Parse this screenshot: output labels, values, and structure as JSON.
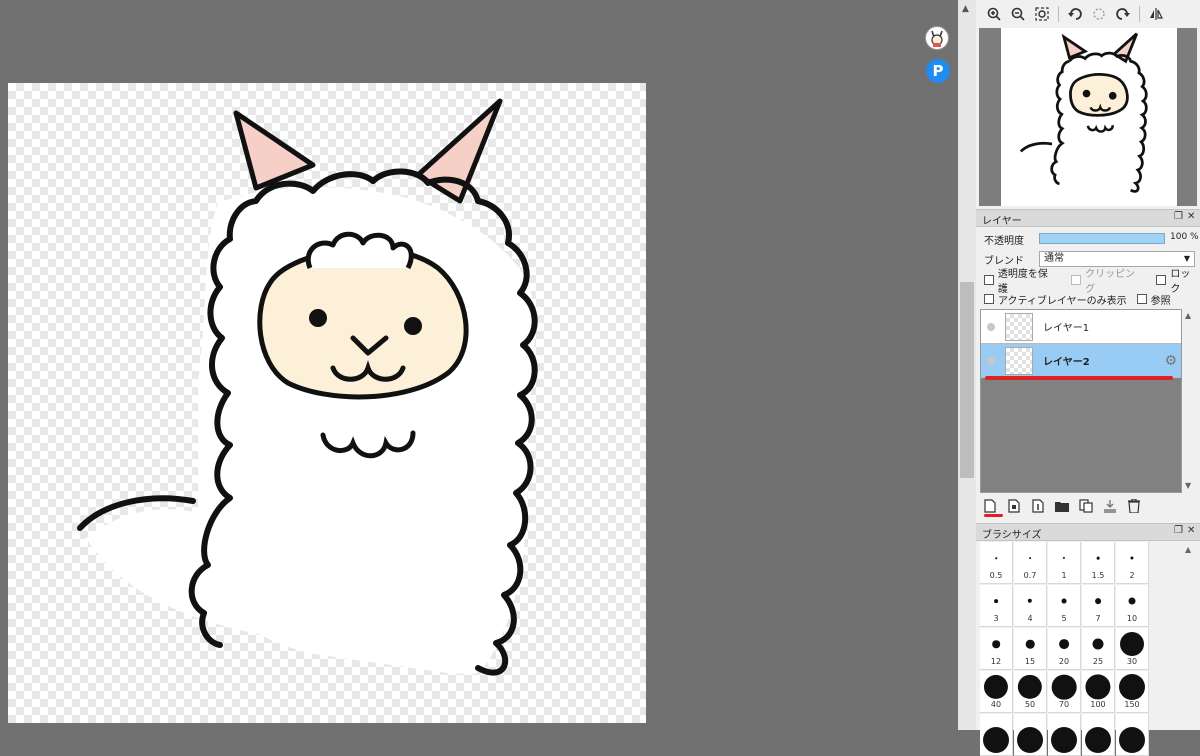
{
  "navigator": {
    "tools": [
      "zoom-in",
      "zoom-out",
      "zoom-fit",
      "rotate-left",
      "rotate-reset",
      "rotate-right",
      "flip-horizontal"
    ]
  },
  "layer_panel": {
    "title": "レイヤー",
    "opacity_label": "不透明度",
    "opacity_value": "100 %",
    "opacity": 1.0,
    "blend_label": "ブレンド",
    "blend_value": "通常",
    "checkboxes": {
      "protect_alpha": "透明度を保護",
      "clipping": "クリッピング",
      "lock": "ロック",
      "active_only": "アクティブレイヤーのみ表示",
      "reference": "参照"
    },
    "layers": [
      {
        "name": "レイヤー1",
        "selected": false
      },
      {
        "name": "レイヤー2",
        "selected": true
      }
    ],
    "tools": [
      "new-layer",
      "new-halftone-layer",
      "new-1bit-layer",
      "new-folder",
      "duplicate-layer",
      "merge-down",
      "delete-layer"
    ]
  },
  "brush_panel": {
    "title": "ブラシサイズ",
    "sizes": [
      {
        "label": "0.5",
        "v": 0.5
      },
      {
        "label": "0.7",
        "v": 0.7
      },
      {
        "label": "1",
        "v": 1
      },
      {
        "label": "1.5",
        "v": 1.5
      },
      {
        "label": "2",
        "v": 2
      },
      {
        "label": "3",
        "v": 3
      },
      {
        "label": "4",
        "v": 4
      },
      {
        "label": "5",
        "v": 5
      },
      {
        "label": "7",
        "v": 7
      },
      {
        "label": "10",
        "v": 10
      },
      {
        "label": "12",
        "v": 12
      },
      {
        "label": "15",
        "v": 15
      },
      {
        "label": "20",
        "v": 20
      },
      {
        "label": "25",
        "v": 25
      },
      {
        "label": "30",
        "v": 30
      },
      {
        "label": "40",
        "v": 40
      },
      {
        "label": "50",
        "v": 50
      },
      {
        "label": "70",
        "v": 70
      },
      {
        "label": "100",
        "v": 100
      },
      {
        "label": "150",
        "v": 150
      },
      {
        "label": "",
        "v": 200
      },
      {
        "label": "",
        "v": 200
      },
      {
        "label": "",
        "v": 200
      },
      {
        "label": "",
        "v": 200
      },
      {
        "label": "",
        "v": 200
      }
    ]
  },
  "colors": {
    "selection": "#99ccf5",
    "highlight_red": "#dd2222",
    "alpaca_face": "#fdf0d8",
    "alpaca_ear": "#f6d0c6"
  }
}
